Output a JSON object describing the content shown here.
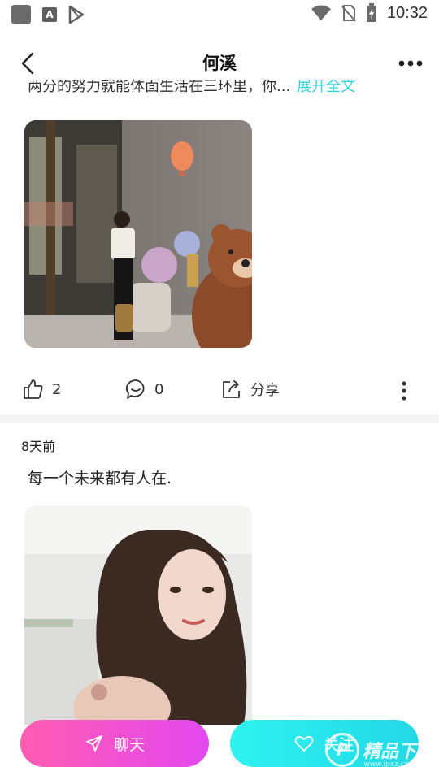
{
  "status_bar": {
    "time": "10:32",
    "icons": [
      "app-square-icon",
      "font-a-icon",
      "play-store-icon",
      "wifi-icon",
      "no-sim-icon",
      "battery-charging-icon"
    ]
  },
  "header": {
    "title": "何溪",
    "back_icon": "chevron-left-icon",
    "more_icon": "more-horizontal-icon"
  },
  "post1": {
    "text_truncated": "两分的努力就能体面生活在三环里，你...",
    "expand_label": "展开全文",
    "image_desc": "photo-woman-with-bear",
    "likes": "2",
    "comments": "0",
    "share_label": "分享"
  },
  "post2": {
    "time": "8天前",
    "text": "每一个未来都有人在.",
    "image_desc": "photo-woman-selfie"
  },
  "bottom": {
    "chat_label": "聊天",
    "follow_label": "关注"
  },
  "watermark": {
    "brand": "精品下载",
    "url": "www.jpxz.com"
  },
  "colors": {
    "accent_cyan": "#2fd3e0",
    "chat_gradient_start": "#ff5cb0",
    "chat_gradient_end": "#e348f0",
    "follow_gradient_start": "#2ef2f0"
  }
}
